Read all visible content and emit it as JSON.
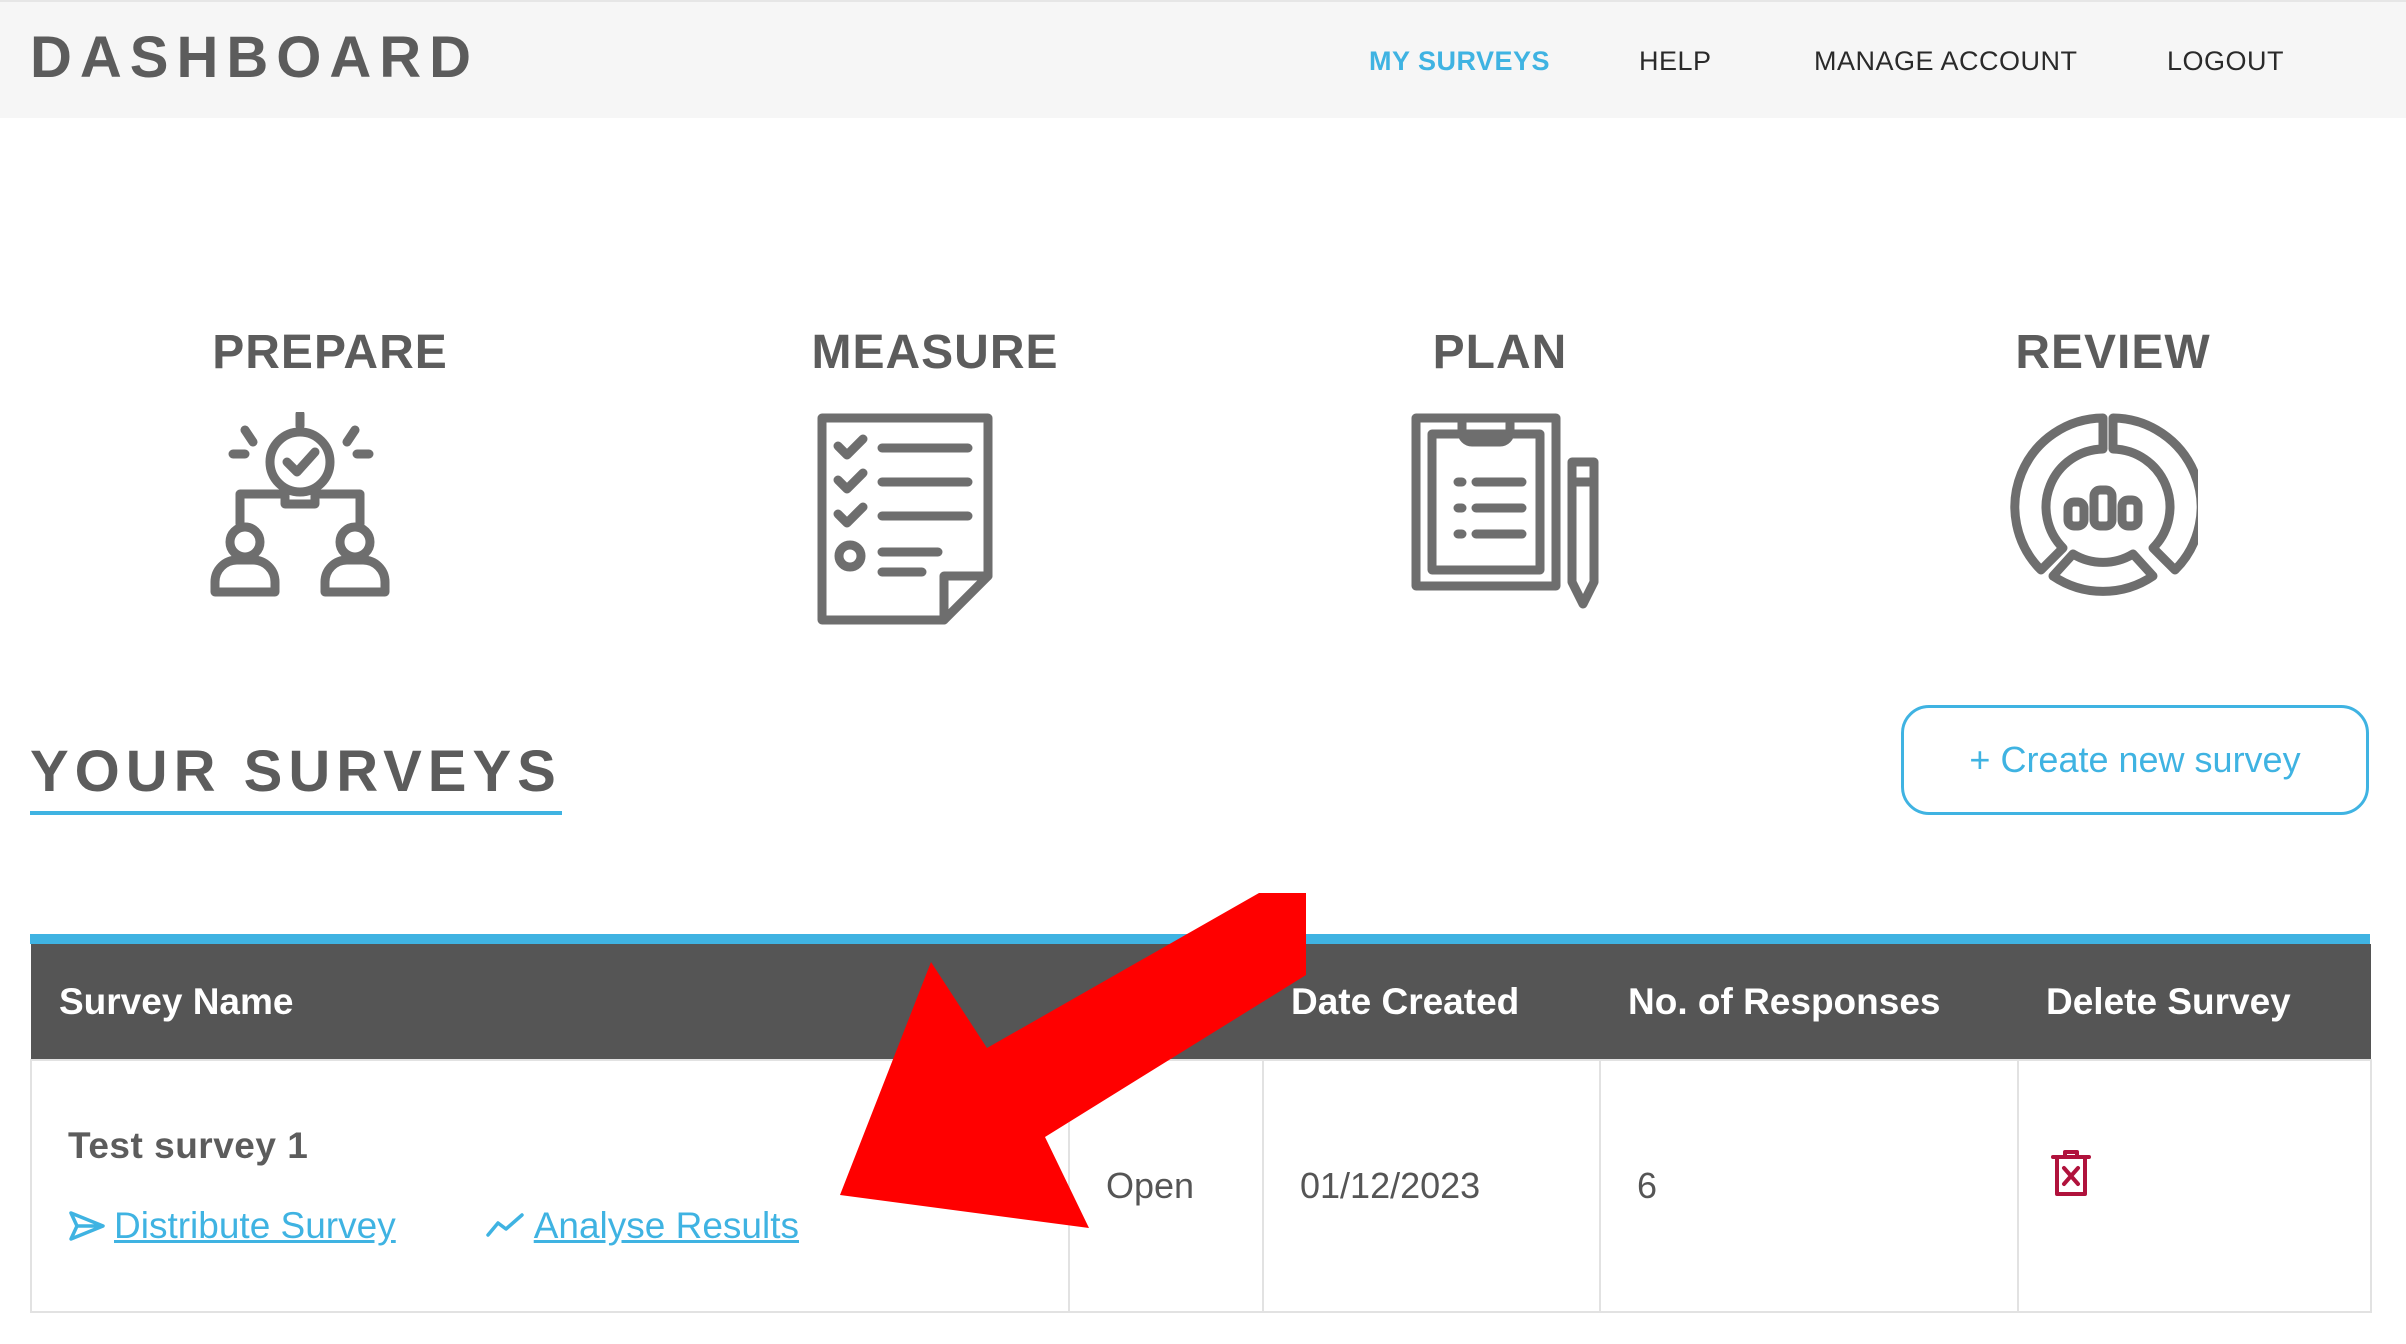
{
  "header": {
    "brand": "DASHBOARD",
    "nav": {
      "my_surveys": "MY SURVEYS",
      "help": "HELP",
      "manage_account": "MANAGE ACCOUNT",
      "logout": "LOGOUT"
    }
  },
  "stages": {
    "prepare": "PREPARE",
    "measure": "MEASURE",
    "plan": "PLAN",
    "review": "REVIEW"
  },
  "surveys_section": {
    "title": "YOUR SURVEYS",
    "create_button": "+ Create new survey"
  },
  "table": {
    "headers": {
      "survey_name": "Survey Name",
      "date_created": "Date Created",
      "responses": "No. of Responses",
      "delete": "Delete Survey"
    },
    "rows": [
      {
        "name": "Test survey 1",
        "distribute_link": " Distribute Survey",
        "analyse_link": " Analyse Results",
        "status": "Open",
        "date_created": "01/12/2023",
        "responses": "6"
      }
    ]
  },
  "colors": {
    "accent": "#3fb3e2",
    "header_bg": "#555555",
    "delete_icon": "#b0123c",
    "annotation_arrow": "#ff0000"
  }
}
